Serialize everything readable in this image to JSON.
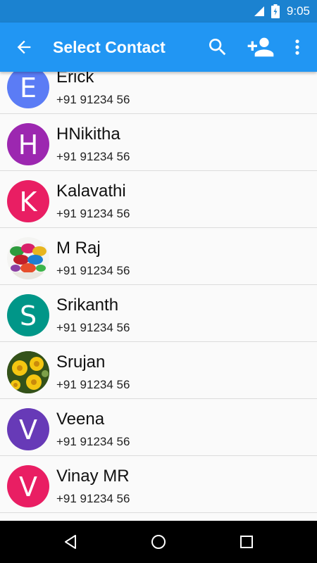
{
  "status_bar": {
    "time": "9:05"
  },
  "app_bar": {
    "title": "Select Contact",
    "accent": "#2196f3"
  },
  "contacts": [
    {
      "initial": "E",
      "name": "Erick",
      "phone": "+91 91234 56",
      "avatar_color": "#5b7cf5",
      "avatar_type": "letter"
    },
    {
      "initial": "H",
      "name": "HNikitha",
      "phone": "+91 91234 56",
      "avatar_color": "#9c27b0",
      "avatar_type": "letter"
    },
    {
      "initial": "K",
      "name": "Kalavathi",
      "phone": "+91 91234 56",
      "avatar_color": "#e91e63",
      "avatar_type": "letter"
    },
    {
      "initial": "",
      "name": "M Raj",
      "phone": "+91 91234 56",
      "avatar_type": "photo-colors"
    },
    {
      "initial": "S",
      "name": "Srikanth",
      "phone": "+91 91234 56",
      "avatar_color": "#009688",
      "avatar_type": "letter"
    },
    {
      "initial": "",
      "name": "Srujan",
      "phone": "+91 91234 56",
      "avatar_type": "photo-flowers"
    },
    {
      "initial": "V",
      "name": "Veena",
      "phone": "+91 91234 56",
      "avatar_color": "#673ab7",
      "avatar_type": "letter"
    },
    {
      "initial": "V",
      "name": "Vinay MR",
      "phone": "+91 91234 56",
      "avatar_color": "#e91e63",
      "avatar_type": "letter"
    }
  ],
  "icons": {
    "back": "arrow-back-icon",
    "search": "search-icon",
    "add_contact": "add-person-icon",
    "more": "more-vert-icon",
    "nav_back": "nav-back-icon",
    "nav_home": "nav-home-icon",
    "nav_recents": "nav-recents-icon"
  }
}
